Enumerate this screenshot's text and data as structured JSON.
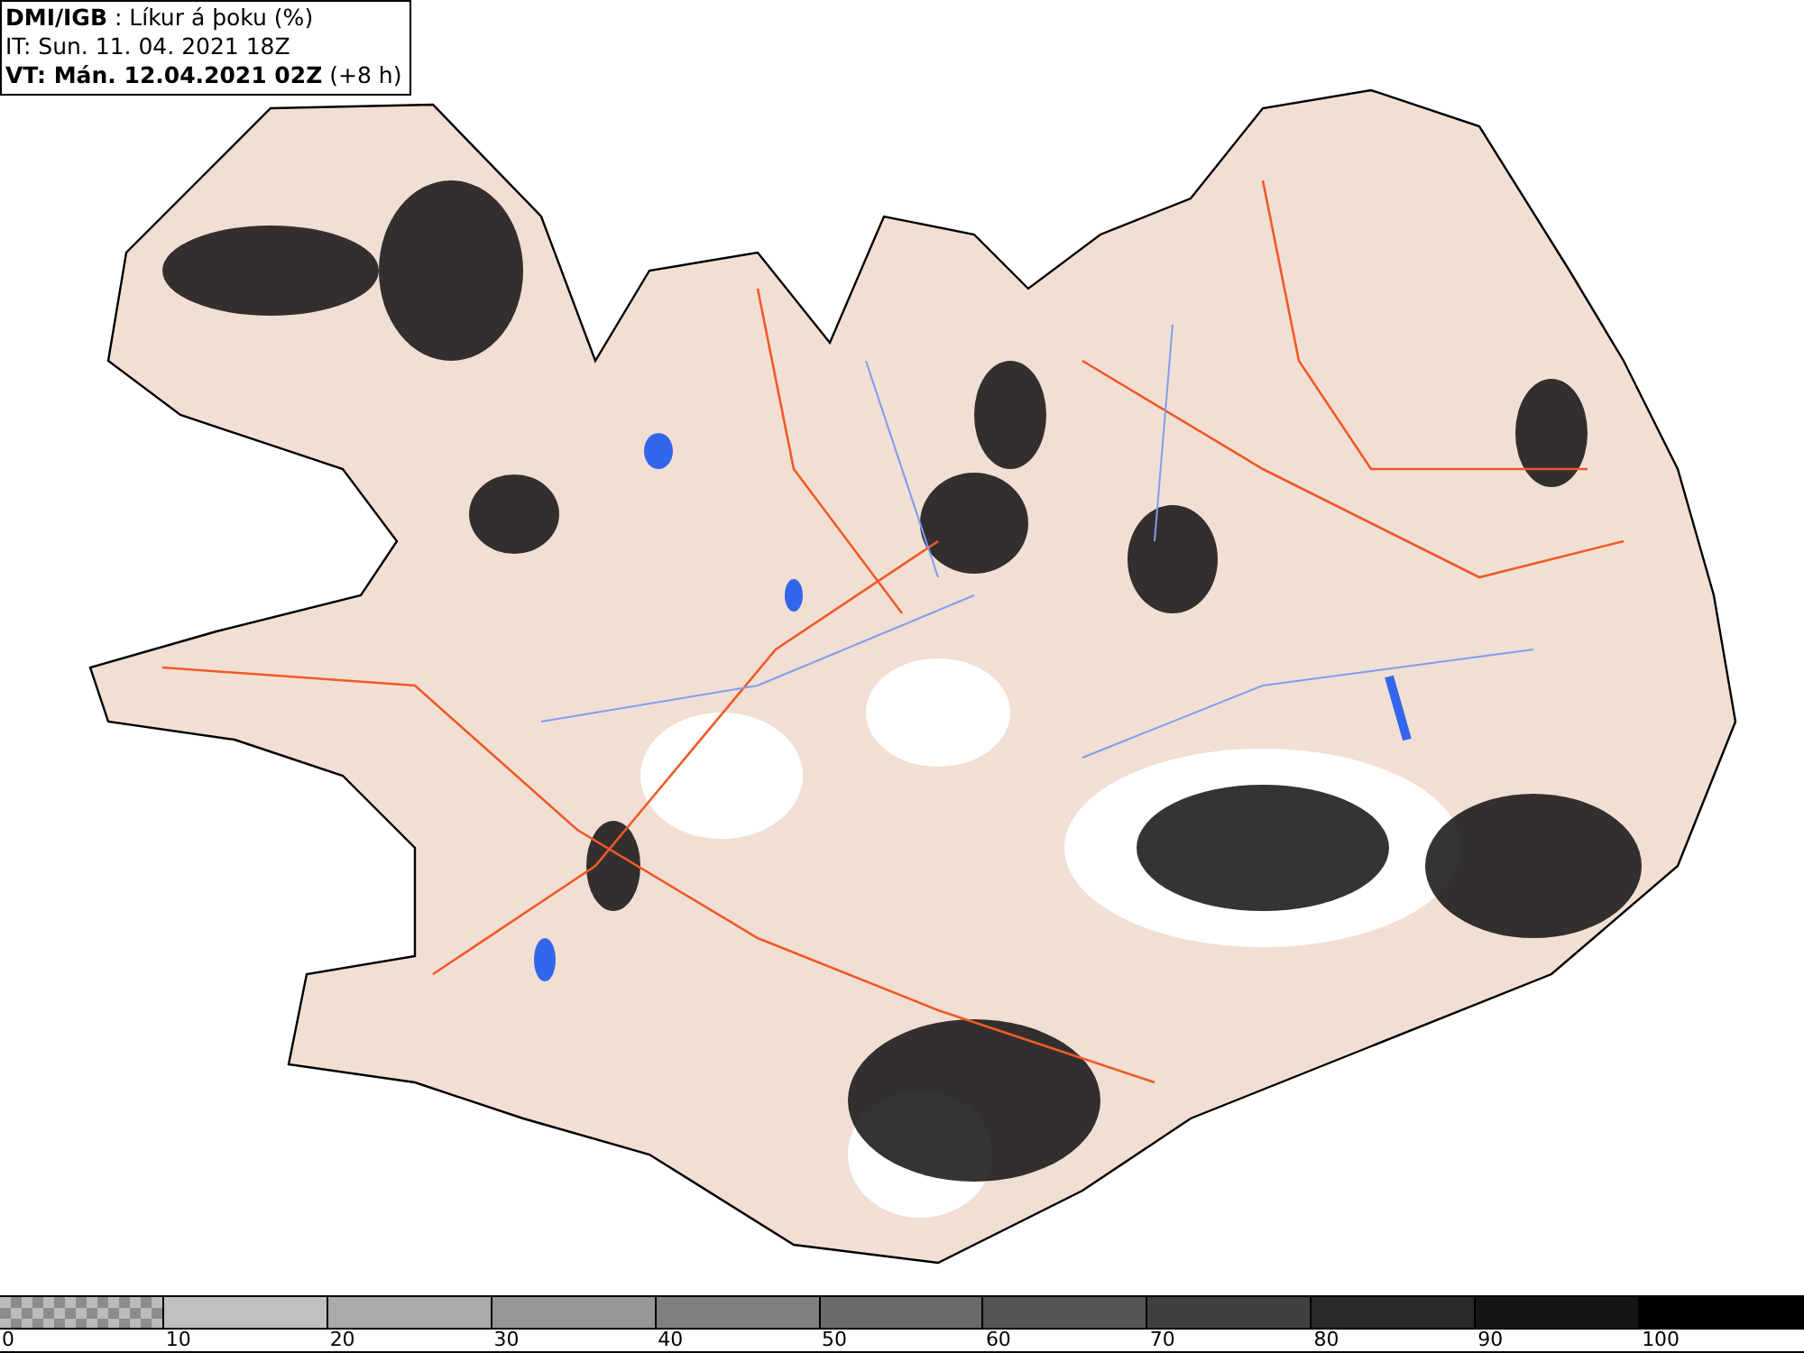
{
  "header": {
    "title": "**DMI/IGB** : Líkur á þoku (%)",
    "issue_time": "IT: Sun. 11. 04. 2021 18Z",
    "valid_time": "**VT: Mán. 12.04.2021 02Z** (+8 h)"
  },
  "legend": [
    {
      "label": "0",
      "kind": "checker",
      "color": "#8c8c8c"
    },
    {
      "label": "10",
      "kind": "solid",
      "color": "#c0c0c0"
    },
    {
      "label": "20",
      "kind": "solid",
      "color": "#aaaaaa"
    },
    {
      "label": "30",
      "kind": "solid",
      "color": "#969696"
    },
    {
      "label": "40",
      "kind": "solid",
      "color": "#808080"
    },
    {
      "label": "50",
      "kind": "solid",
      "color": "#6a6a6a"
    },
    {
      "label": "60",
      "kind": "solid",
      "color": "#555555"
    },
    {
      "label": "70",
      "kind": "solid",
      "color": "#404040"
    },
    {
      "label": "80",
      "kind": "solid",
      "color": "#2a2a2a"
    },
    {
      "label": "90",
      "kind": "solid",
      "color": "#151515"
    },
    {
      "label": "100",
      "kind": "solid",
      "color": "#000000"
    }
  ]
}
